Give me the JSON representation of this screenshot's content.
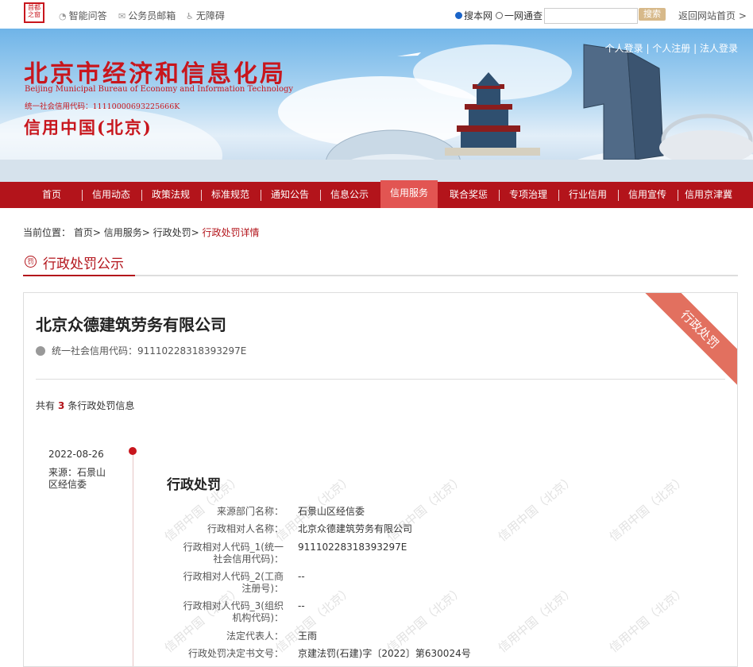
{
  "topbar": {
    "logo_text": "首都之窗",
    "links": [
      {
        "label": "智能问答",
        "icon": "headset-icon"
      },
      {
        "label": "公务员邮箱",
        "icon": "mail-icon"
      },
      {
        "label": "无障碍",
        "icon": "accessibility-icon"
      }
    ],
    "search_scope": [
      {
        "label": "搜本网",
        "selected": true
      },
      {
        "label": "一网通查",
        "selected": false
      }
    ],
    "search_placeholder": "",
    "search_button": "搜索",
    "back_link": "返回网站首页 >"
  },
  "banner": {
    "title": "北京市经济和信息化局",
    "title_en": "Beijing Municipal Bureau of Economy and Information Technology",
    "code_line": "统一社会信用代码：11110000693225666K",
    "subtitle": "信用中国(北京)",
    "user_links": [
      "个人登录",
      "个人注册",
      "法人登录"
    ]
  },
  "nav": {
    "items": [
      "首页",
      "信用动态",
      "政策法规",
      "标准规范",
      "通知公告",
      "信息公示",
      "信用服务",
      "联合奖惩",
      "专项治理",
      "行业信用",
      "信用宣传",
      "信用京津冀"
    ],
    "active_index": 6
  },
  "breadcrumb": {
    "prefix": "当前位置：",
    "items": [
      "首页>",
      "信用服务>",
      "行政处罚>"
    ],
    "current": "行政处罚详情"
  },
  "section": {
    "icon_text": "罚",
    "title": "行政处罚公示"
  },
  "entity": {
    "ribbon": "行政处罚",
    "name": "北京众德建筑劳务有限公司",
    "credit_code_label": "统一社会信用代码：",
    "credit_code": "91110228318393297E",
    "count_prefix": "共有",
    "count": "3",
    "count_suffix": "条行政处罚信息"
  },
  "record": {
    "date": "2022-08-26",
    "source": "来源：石景山区经信委",
    "title": "行政处罚",
    "fields": [
      {
        "label": "来源部门名称：",
        "value": "石景山区经信委"
      },
      {
        "label": "行政相对人名称：",
        "value": "北京众德建筑劳务有限公司"
      },
      {
        "label": "行政相对人代码_1(统一社会信用代码)：",
        "value": "91110228318393297E"
      },
      {
        "label": "行政相对人代码_2(工商注册号)：",
        "value": "--"
      },
      {
        "label": "行政相对人代码_3(组织机构代码)：",
        "value": "--"
      },
      {
        "label": "法定代表人：",
        "value": "王雨"
      },
      {
        "label": "行政处罚决定书文号：",
        "value": "京建法罚(石建)字〔2022〕第630024号"
      }
    ],
    "watermark": "信用中国（北京）"
  },
  "colors": {
    "brand_red": "#b3141b",
    "accent": "#c8161d"
  }
}
